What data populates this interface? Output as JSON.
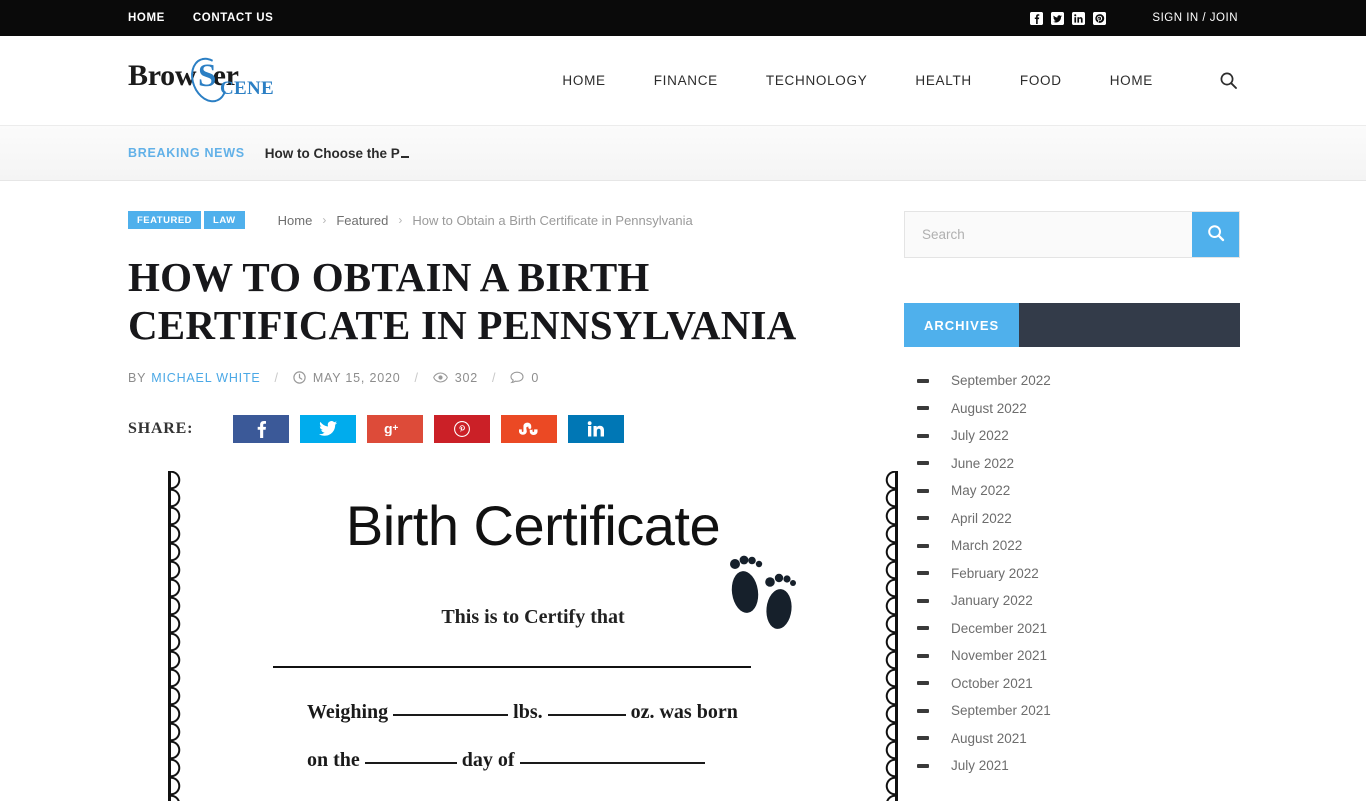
{
  "topbar": {
    "links": [
      {
        "label": "HOME"
      },
      {
        "label": "CONTACT US"
      }
    ],
    "social": [
      {
        "name": "facebook-icon"
      },
      {
        "name": "twitter-icon"
      },
      {
        "name": "linkedin-icon"
      },
      {
        "name": "pinterest-icon"
      }
    ],
    "signin_label": "SIGN IN / JOIN",
    "background": "#0a0a0a"
  },
  "header": {
    "logo": {
      "main": "Brow",
      "s": "S",
      "tail": "er",
      "sub": "CENE",
      "alt": "BrowserScene"
    },
    "nav": [
      {
        "label": "HOME"
      },
      {
        "label": "FINANCE"
      },
      {
        "label": "TECHNOLOGY"
      },
      {
        "label": "HEALTH"
      },
      {
        "label": "FOOD"
      },
      {
        "label": "HOME"
      }
    ],
    "search_icon": "search-icon"
  },
  "breaking": {
    "label": "BREAKING NEWS",
    "text": "How to Choose the P"
  },
  "article": {
    "badges": [
      {
        "label": "FEATURED"
      },
      {
        "label": "LAW"
      }
    ],
    "breadcrumb": {
      "home": "Home",
      "category": "Featured",
      "current": "How to Obtain a Birth Certificate in Pennsylvania",
      "separator": "›"
    },
    "title": "How to Obtain a Birth Certificate in Pennsylvania",
    "meta": {
      "by_label": "BY",
      "author": "MICHAEL WHITE",
      "date": "MAY 15, 2020",
      "views": "302",
      "comments": "0",
      "separator": "/"
    },
    "share": {
      "label": "SHARE:",
      "buttons": [
        {
          "name": "facebook",
          "glyph": "f",
          "color": "#3b5998"
        },
        {
          "name": "twitter",
          "glyph": "t",
          "color": "#00aced"
        },
        {
          "name": "googleplus",
          "glyph": "g+",
          "color": "#dd4b39"
        },
        {
          "name": "pinterest",
          "glyph": "p",
          "color": "#cb2027"
        },
        {
          "name": "stumbleupon",
          "glyph": "su",
          "color": "#eb4924"
        },
        {
          "name": "linkedin",
          "glyph": "in",
          "color": "#0077b5"
        }
      ]
    },
    "featured_image": {
      "alt": "Birth Certificate blank template with footprints",
      "heading": "Birth Certificate",
      "subheading": "This is to Certify that",
      "line1_a": "Weighing",
      "line1_b": "lbs.",
      "line1_c": "oz. was born",
      "line2_a": "on the",
      "line2_b": "day of"
    }
  },
  "sidebar": {
    "search": {
      "placeholder": "Search",
      "value": "",
      "button_icon": "search-icon"
    },
    "archives": {
      "title": "ARCHIVES",
      "items": [
        {
          "label": "September 2022"
        },
        {
          "label": "August 2022"
        },
        {
          "label": "July 2022"
        },
        {
          "label": "June 2022"
        },
        {
          "label": "May 2022"
        },
        {
          "label": "April 2022"
        },
        {
          "label": "March 2022"
        },
        {
          "label": "February 2022"
        },
        {
          "label": "January 2022"
        },
        {
          "label": "December 2021"
        },
        {
          "label": "November 2021"
        },
        {
          "label": "October 2021"
        },
        {
          "label": "September 2021"
        },
        {
          "label": "August 2021"
        },
        {
          "label": "July 2021"
        }
      ]
    }
  },
  "colors": {
    "accent_blue": "#4fb0ec",
    "dark_navy": "#333b49",
    "topbar_black": "#0a0a0a",
    "logo_blue": "#2b7fc4"
  }
}
